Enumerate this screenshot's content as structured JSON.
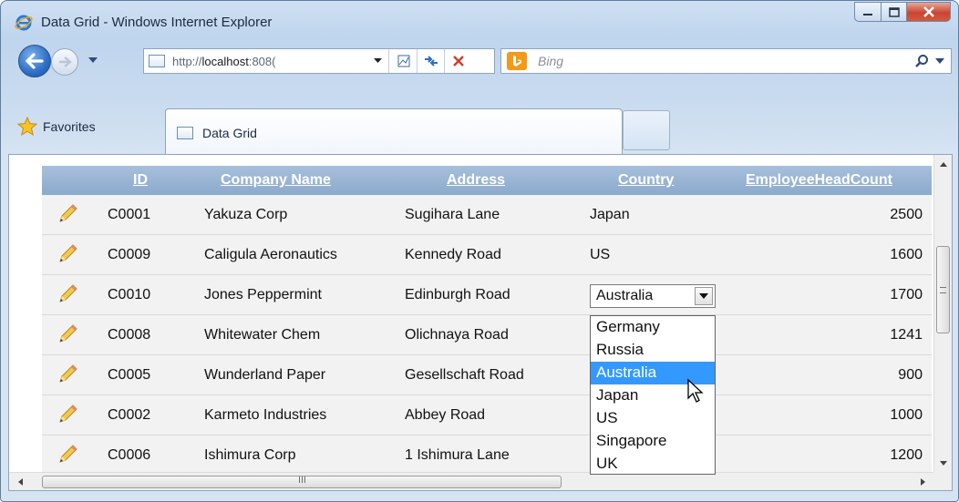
{
  "window": {
    "title": "Data Grid - Windows Internet Explorer"
  },
  "address_bar": {
    "url_prefix": "http://",
    "url_host": "localhost",
    "url_rest": ":808(",
    "search_placeholder": "Bing"
  },
  "tabs": {
    "favorites_label": "Favorites",
    "active_tab_label": "Data Grid"
  },
  "grid": {
    "columns": [
      "ID",
      "Company Name",
      "Address",
      "Country",
      "EmployeeHeadCount"
    ],
    "rows": [
      {
        "id": "C0001",
        "company": "Yakuza Corp",
        "address": "Sugihara Lane",
        "country": "Japan",
        "headcount": "2500"
      },
      {
        "id": "C0009",
        "company": "Caligula Aeronautics",
        "address": "Kennedy Road",
        "country": "US",
        "headcount": "1600"
      },
      {
        "id": "C0010",
        "company": "Jones Peppermint",
        "address": "Edinburgh Road",
        "country": "Australia",
        "headcount": "1700"
      },
      {
        "id": "C0008",
        "company": "Whitewater Chem",
        "address": "Olichnaya Road",
        "country": "",
        "headcount": "1241"
      },
      {
        "id": "C0005",
        "company": "Wunderland Paper",
        "address": "Gesellschaft Road",
        "country": "",
        "headcount": "900"
      },
      {
        "id": "C0002",
        "company": "Karmeto Industries",
        "address": "Abbey Road",
        "country": "",
        "headcount": "1000"
      },
      {
        "id": "C0006",
        "company": "Ishimura Corp",
        "address": "1 Ishimura Lane",
        "country": "",
        "headcount": "1200"
      }
    ]
  },
  "country_dropdown": {
    "selected": "Australia",
    "options": [
      "Germany",
      "Russia",
      "Australia",
      "Japan",
      "US",
      "Singapore",
      "UK"
    ]
  },
  "scrollbar": {
    "h_grip": "III"
  },
  "colors": {
    "header_bg": "#98b3d4",
    "selection": "#3399ff",
    "row_bg": "#f2f2f2"
  }
}
